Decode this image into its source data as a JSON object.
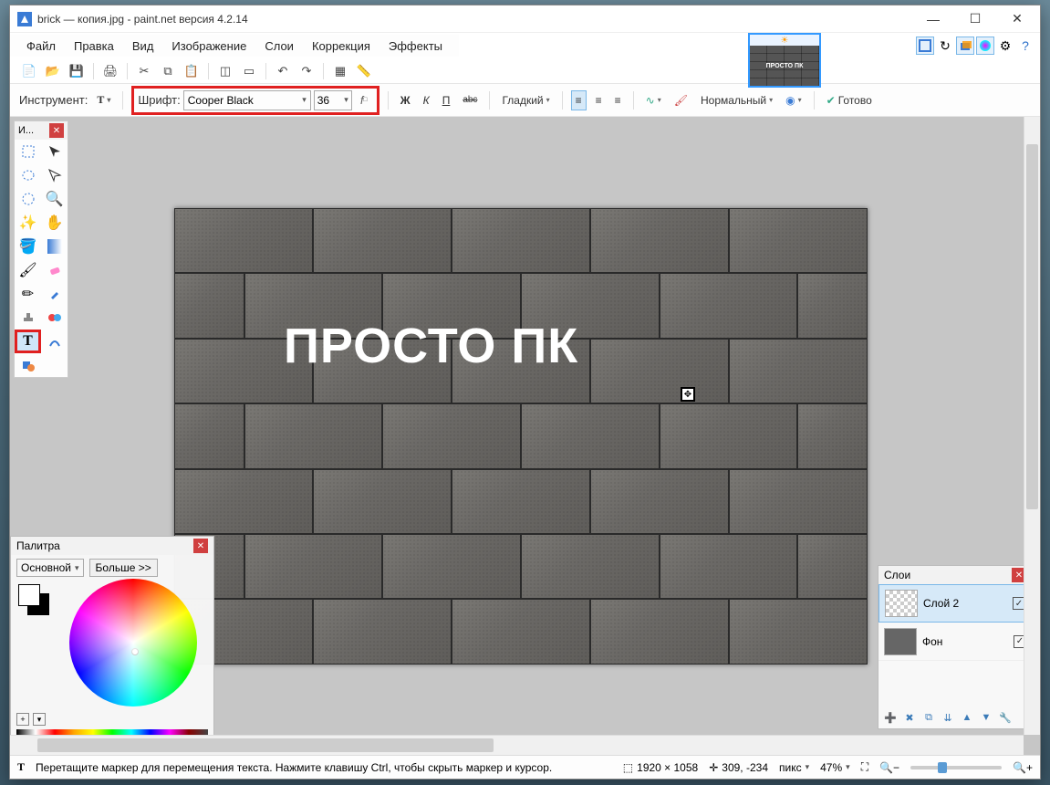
{
  "titlebar": {
    "title": "brick — копия.jpg - paint.net версия 4.2.14"
  },
  "thumb_text": "ПРОСТО ПК",
  "menubar": [
    "Файл",
    "Правка",
    "Вид",
    "Изображение",
    "Слои",
    "Коррекция",
    "Эффекты"
  ],
  "toolbar2": {
    "tool_label": "Инструмент:",
    "font_label": "Шрифт:",
    "font_name": "Cooper Black",
    "font_size": "36",
    "bold": "Ж",
    "italic": "К",
    "underline": "П",
    "strike": "abc",
    "render_label": "Гладкий",
    "fill_label": "Нормальный",
    "finish": "Готово"
  },
  "tools_panel": {
    "title": "И..."
  },
  "canvas": {
    "text": "ПРОСТО ПК"
  },
  "palette": {
    "title": "Палитра",
    "primary_label": "Основной",
    "more_label": "Больше >>"
  },
  "layers": {
    "title": "Слои",
    "items": [
      {
        "name": "Слой 2",
        "checked": true,
        "selected": true
      },
      {
        "name": "Фон",
        "checked": true,
        "selected": false
      }
    ]
  },
  "statusbar": {
    "hint": "Перетащите маркер для перемещения текста. Нажмите клавишу Ctrl, чтобы скрыть маркер и курсор.",
    "dimensions": "1920 × 1058",
    "cursor": "309, -234",
    "unit": "пикс",
    "zoom": "47%"
  },
  "win_buttons": {
    "min": "—",
    "max": "☐",
    "close": "✕"
  }
}
